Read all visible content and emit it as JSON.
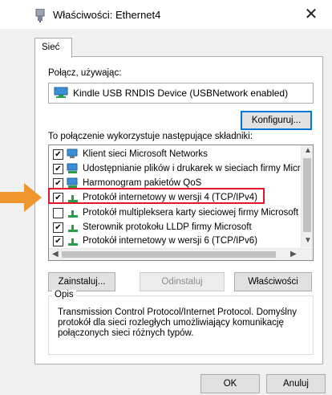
{
  "window": {
    "title": "Właściwości: Ethernet4",
    "close": "✕"
  },
  "tabs": [
    "Sieć"
  ],
  "connect_label": "Połącz, używając:",
  "device": "Kindle USB RNDIS Device (USBNetwork enabled)",
  "configure_button": "Konfiguruj...",
  "components_label": "To połączenie wykorzystuje następujące składniki:",
  "components": [
    {
      "label": "Klient sieci Microsoft Networks",
      "checked": true,
      "icon": "network-client-icon"
    },
    {
      "label": "Udostępnianie plików i drukarek w sieciach firmy Micros",
      "checked": true,
      "icon": "file-printer-sharing-icon"
    },
    {
      "label": "Harmonogram pakietów QoS",
      "checked": true,
      "icon": "network-service-icon"
    },
    {
      "label": "Protokół internetowy w wersji 4 (TCP/IPv4)",
      "checked": true,
      "icon": "protocol-icon"
    },
    {
      "label": "Protokół multipleksera karty sieciowej firmy Microsoft",
      "checked": false,
      "icon": "protocol-icon"
    },
    {
      "label": "Sterownik protokołu LLDP firmy Microsoft",
      "checked": true,
      "icon": "protocol-icon"
    },
    {
      "label": "Protokół internetowy w wersji 6 (TCP/IPv6)",
      "checked": true,
      "icon": "protocol-icon"
    }
  ],
  "buttons": {
    "install": "Zainstaluj...",
    "uninstall": "Odinstaluj",
    "properties": "Właściwości"
  },
  "description": {
    "title": "Opis",
    "text": "Transmission Control Protocol/Internet Protocol. Domyślny protokół dla sieci rozległych umożliwiający komunikację połączonych sieci różnych typów."
  },
  "footer": {
    "ok": "OK",
    "cancel": "Anuluj"
  },
  "colors": {
    "highlight": "#e3182d",
    "arrow": "#f0962e",
    "focus": "#0078d7"
  }
}
